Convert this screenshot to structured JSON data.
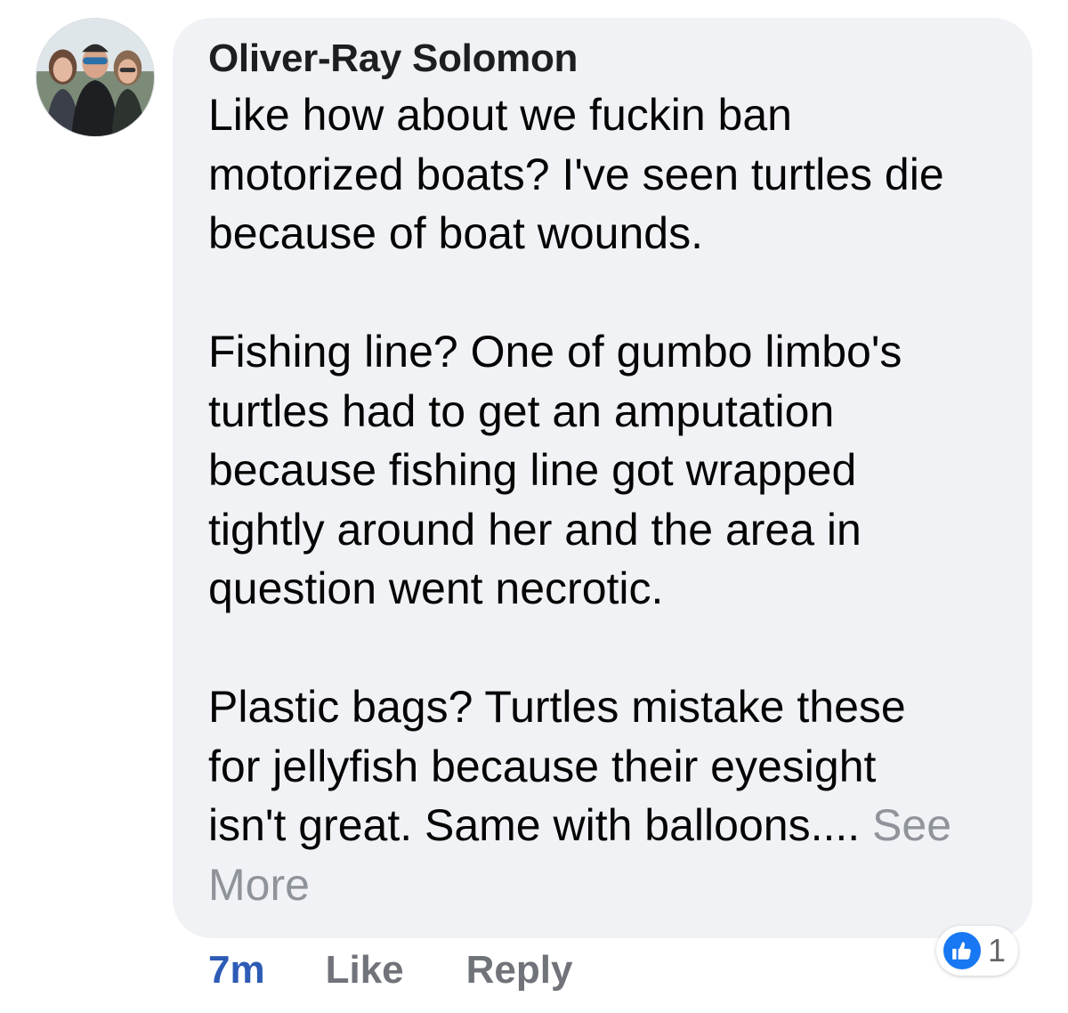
{
  "comment": {
    "author": "Oliver-Ray Solomon",
    "paragraphs": [
      [
        "Like how about we fuckin ban",
        "motorized boats? I've seen turtles die",
        "because of boat wounds."
      ],
      [
        "Fishing line? One of gumbo limbo's",
        "turtles had to get an amputation",
        "because fishing line got wrapped",
        "tightly around her and the area in",
        "question went necrotic."
      ],
      [
        "Plastic bags? Turtles mistake these",
        "for jellyfish because their eyesight",
        "isn't great. Same with balloons.... "
      ]
    ],
    "see_more": "See More",
    "timestamp": "7m",
    "like_label": "Like",
    "reply_label": "Reply",
    "reaction_count": "1"
  },
  "icons": {
    "avatar": "profile-photo",
    "reaction": "thumbs-up-icon"
  },
  "colors": {
    "bubble_bg": "#f0f2f5",
    "timestamp": "#2d5bb5",
    "like_blue": "#1877f2",
    "see_more": "#8f939a"
  }
}
